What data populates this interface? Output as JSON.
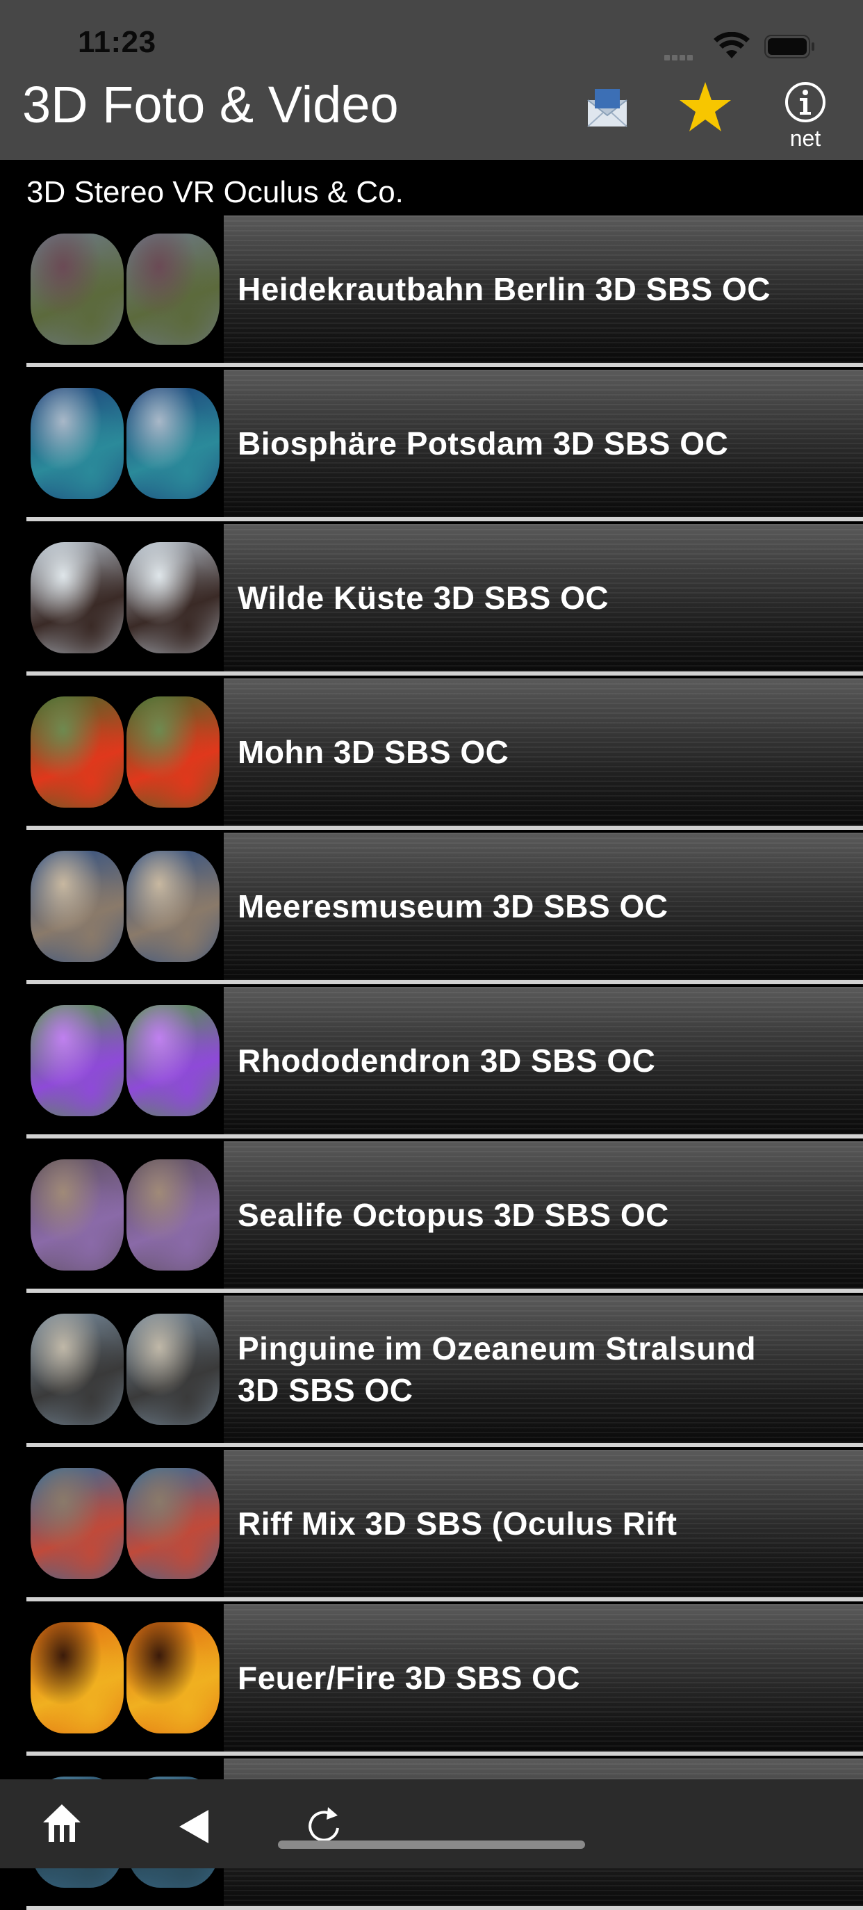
{
  "status": {
    "time": "11:23"
  },
  "header": {
    "title": "3D Foto & Video",
    "info_label": "net",
    "star_color": "#F7C600"
  },
  "section": {
    "title": "3D Stereo VR Oculus & Co."
  },
  "items": [
    {
      "title": "Heidekrautbahn Berlin 3D SBS OC",
      "thumb": [
        "#6e7a8a",
        "#5c6a3c",
        "#6b4a55"
      ]
    },
    {
      "title": "Biosphäre Potsdam 3D SBS OC",
      "thumb": [
        "#1c3e78",
        "#2b8a9a",
        "#a9b8c8"
      ]
    },
    {
      "title": "Wilde Küste 3D SBS OC",
      "thumb": [
        "#b8c4d0",
        "#3a2a26",
        "#dfe6ea"
      ]
    },
    {
      "title": "Mohn 3D SBS OC",
      "thumb": [
        "#3e6a2a",
        "#e0381c",
        "#6e8a50"
      ]
    },
    {
      "title": "Meeresmuseum 3D SBS OC",
      "thumb": [
        "#2a4e86",
        "#8a7a6a",
        "#c8b8a0"
      ]
    },
    {
      "title": "Rhododendron 3D SBS OC",
      "thumb": [
        "#4e9a3a",
        "#8e4ad8",
        "#c080f0"
      ]
    },
    {
      "title": "Sealife Octopus 3D SBS OC",
      "thumb": [
        "#5a4e58",
        "#8a6aa8",
        "#a08a78"
      ]
    },
    {
      "title": [
        "Pinguine im Ozeaneum Stralsund",
        "3D SBS OC"
      ],
      "thumb": [
        "#7a8ea0",
        "#3a3a3a",
        "#c0b8a8"
      ]
    },
    {
      "title": "Riff Mix 3D SBS (Oculus Rift",
      "thumb": [
        "#2a6ea0",
        "#c04a3a",
        "#8a7a6a"
      ]
    },
    {
      "title": "Feuer/Fire 3D SBS OC",
      "thumb": [
        "#e06a10",
        "#f0b020",
        "#3a1a0a"
      ]
    },
    {
      "title": "",
      "thumb": [
        "#3a6a8a",
        "#2a4a5a",
        "#5a8aa0"
      ]
    }
  ]
}
